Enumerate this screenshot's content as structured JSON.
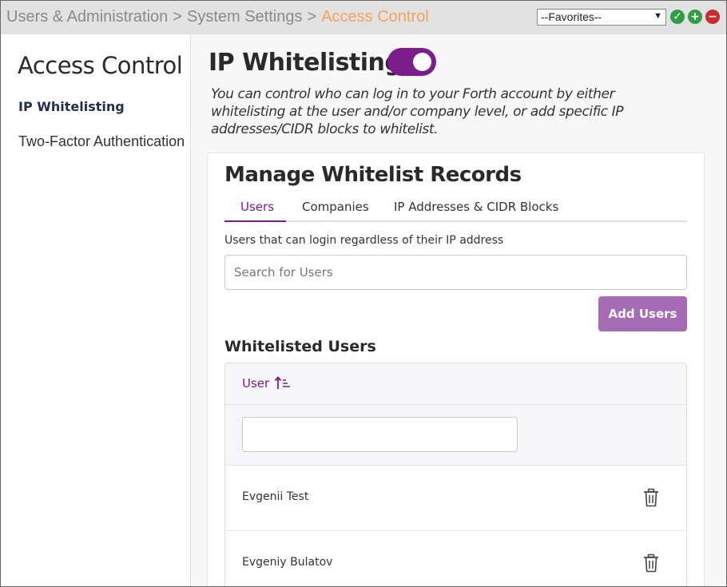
{
  "breadcrumb": {
    "items": [
      "Users & Administration",
      "System Settings"
    ],
    "separator": ">",
    "current": "Access Control",
    "current_color": "#f5a25d"
  },
  "favorites": {
    "selected": "--Favorites--"
  },
  "toolbar_icons": [
    "check-circle-icon",
    "plus-circle-icon",
    "minus-circle-icon"
  ],
  "sidebar": {
    "title": "Access Control",
    "items": [
      {
        "label": "IP Whitelisting",
        "active": true
      },
      {
        "label": "Two-Factor Authentication",
        "active": false
      }
    ]
  },
  "main": {
    "title": "IP Whitelisting",
    "toggle_on": true,
    "accent_color": "#7d1c8c",
    "description": "You can control who can log in to your Forth account by either whitelisting at the user and/or company level, or add specific IP addresses/CIDR blocks to whitelist.",
    "card": {
      "title": "Manage Whitelist Records",
      "tabs": [
        {
          "label": "Users",
          "active": true
        },
        {
          "label": "Companies",
          "active": false
        },
        {
          "label": "IP Addresses & CIDR Blocks",
          "active": false
        }
      ],
      "hint": "Users that can login regardless of their IP address",
      "search_placeholder": "Search for Users",
      "add_button": "Add Users",
      "section_title": "Whitelisted Users",
      "grid": {
        "column": "User",
        "sort": "ascending",
        "filter_value": "",
        "rows": [
          "Evgenii Test",
          "Evgeniy Bulatov"
        ]
      }
    }
  }
}
